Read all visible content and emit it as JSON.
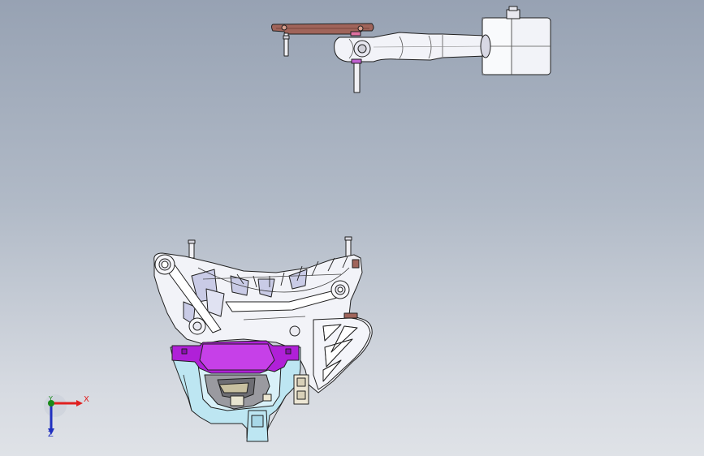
{
  "viewport": {
    "background_top": "#97a2b3",
    "background_bottom": "#dfe2e7"
  },
  "triad": {
    "x_label": "X",
    "y_label": "Y",
    "z_label": "Z",
    "x_color": "#e02020",
    "y_color": "#1a8a1a",
    "z_color": "#2030c0"
  },
  "colors": {
    "link_plate": "#a0645a",
    "purple_part": "#b020d8",
    "bracket_body": "#f2f3f8",
    "bracket_shade": "#c9cbe6",
    "blue_frame": "#bde6f2",
    "dark_edge": "#202020"
  }
}
